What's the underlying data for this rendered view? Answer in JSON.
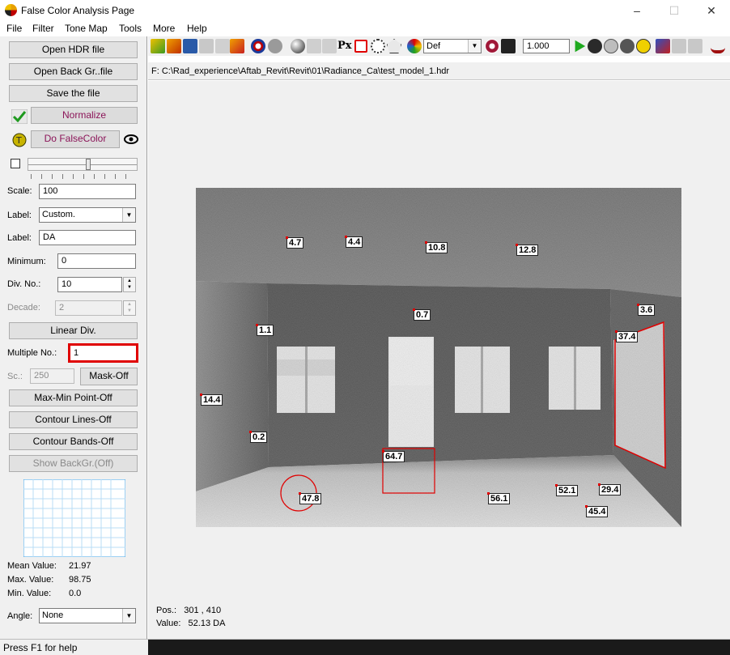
{
  "window": {
    "title": "False Color Analysis Page",
    "minimize": "–",
    "maximize": "☐",
    "close": "✕"
  },
  "menu": [
    "File",
    "Filter",
    "Tone Map",
    "Tools",
    "More",
    "Help"
  ],
  "left": {
    "open_hdr": "Open HDR file",
    "open_back": "Open Back Gr..file",
    "save": "Save the file",
    "normalize": "Normalize",
    "do_falsecolor": "Do FalseColor",
    "scale_label": "Scale:",
    "scale_value": "100",
    "label1_label": "Label:",
    "label1_value": "Custom.",
    "label2_label": "Label:",
    "label2_value": "DA",
    "min_label": "Minimum:",
    "min_value": "0",
    "div_label": "Div. No.:",
    "div_value": "10",
    "decade_label": "Decade:",
    "decade_value": "2",
    "linear_div": "Linear Div.",
    "multiple_label": "Multiple No.:",
    "multiple_value": "1",
    "sc_label": "Sc.:",
    "sc_value": "250",
    "mask_off": "Mask-Off",
    "maxmin": "Max-Min Point-Off",
    "contour_lines": "Contour Lines-Off",
    "contour_bands": "Contour Bands-Off",
    "show_backgr": "Show BackGr.(Off)",
    "mean_label": "Mean Value:",
    "mean_value": "21.97",
    "max_label": "Max. Value:",
    "max_value": "98.75",
    "min_v_label": "Min. Value:",
    "min_v_value": "0.0",
    "angle_label": "Angle:",
    "angle_value": "None"
  },
  "toolbar": {
    "select_value": "Def",
    "zoom_value": "1.000",
    "px_label": "Px"
  },
  "path": "F: C:\\Rad_experience\\Aftab_Revit\\Revit\\01\\Radiance_Ca\\test_model_1.hdr",
  "points": [
    "4.7",
    "4.4",
    "10.8",
    "12.8",
    "0.7",
    "3.6",
    "1.1",
    "37.4",
    "14.4",
    "0.2",
    "64.7",
    "47.8",
    "56.1",
    "52.1",
    "29.4",
    "45.4"
  ],
  "readout": {
    "pos_label": "Pos.:",
    "pos_value": "301 , 410",
    "value_label": "Value:",
    "value_value": "52.13 DA"
  },
  "status": "Press F1 for help",
  "colors": {
    "highlight": "#e00000",
    "accent_pink": "#8b1458"
  }
}
